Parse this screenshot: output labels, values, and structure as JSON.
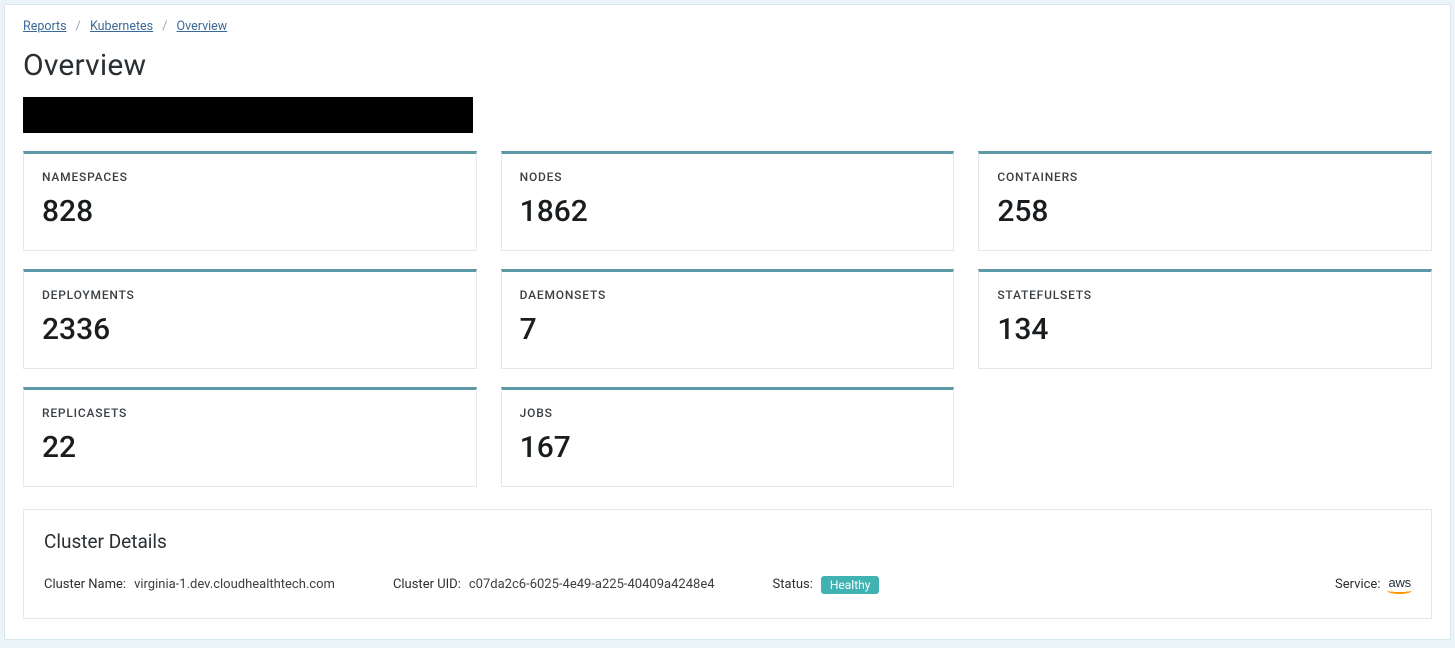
{
  "breadcrumb": {
    "items": [
      "Reports",
      "Kubernetes",
      "Overview"
    ]
  },
  "page_title": "Overview",
  "cards": [
    {
      "label": "NAMESPACES",
      "value": "828"
    },
    {
      "label": "NODES",
      "value": "1862"
    },
    {
      "label": "CONTAINERS",
      "value": "258"
    },
    {
      "label": "DEPLOYMENTS",
      "value": "2336"
    },
    {
      "label": "DAEMONSETS",
      "value": "7"
    },
    {
      "label": "STATEFULSETS",
      "value": "134"
    },
    {
      "label": "REPLICASETS",
      "value": "22"
    },
    {
      "label": "JOBS",
      "value": "167"
    }
  ],
  "cluster_details": {
    "title": "Cluster Details",
    "name_label": "Cluster Name:",
    "name_value": "virginia-1.dev.cloudhealthtech.com",
    "uid_label": "Cluster UID:",
    "uid_value": "c07da2c6-6025-4e49-a225-40409a4248e4",
    "status_label": "Status:",
    "status_value": "Healthy",
    "service_label": "Service:",
    "service_value": "aws"
  }
}
